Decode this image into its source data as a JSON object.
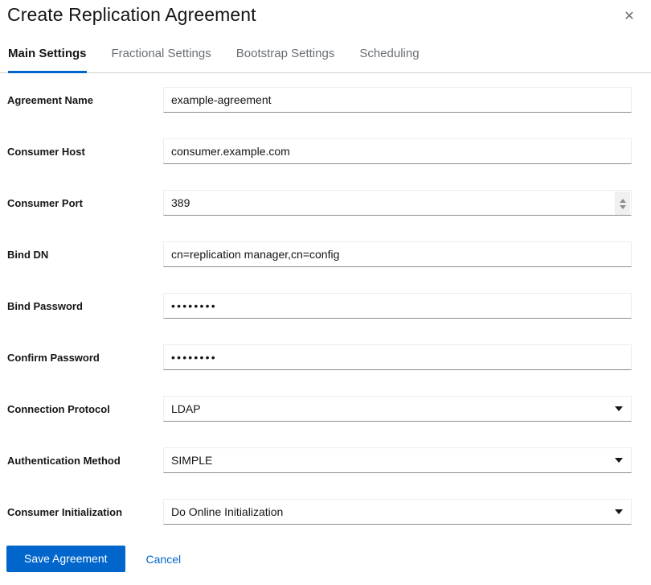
{
  "header": {
    "title": "Create Replication Agreement",
    "close_label": "✕"
  },
  "tabs": [
    {
      "label": "Main Settings",
      "active": true
    },
    {
      "label": "Fractional Settings",
      "active": false
    },
    {
      "label": "Bootstrap Settings",
      "active": false
    },
    {
      "label": "Scheduling",
      "active": false
    }
  ],
  "fields": [
    {
      "label": "Agreement Name",
      "value": "example-agreement",
      "type": "text"
    },
    {
      "label": "Consumer Host",
      "value": "consumer.example.com",
      "type": "text"
    },
    {
      "label": "Consumer Port",
      "value": "389",
      "type": "number"
    },
    {
      "label": "Bind DN",
      "value": "cn=replication manager,cn=config",
      "type": "text"
    },
    {
      "label": "Bind Password",
      "value": "••••••••",
      "type": "password"
    },
    {
      "label": "Confirm Password",
      "value": "••••••••",
      "type": "password"
    },
    {
      "label": "Connection Protocol",
      "value": "LDAP",
      "type": "select"
    },
    {
      "label": "Authentication Method",
      "value": "SIMPLE",
      "type": "select"
    },
    {
      "label": "Consumer Initialization",
      "value": "Do Online Initialization",
      "type": "select"
    }
  ],
  "footer": {
    "save_label": "Save Agreement",
    "cancel_label": "Cancel"
  },
  "colors": {
    "accent": "#0066CC",
    "text": "#151515",
    "muted": "#6A6E73",
    "border_bottom": "#8A8D90",
    "border_light": "#EDEDED"
  }
}
